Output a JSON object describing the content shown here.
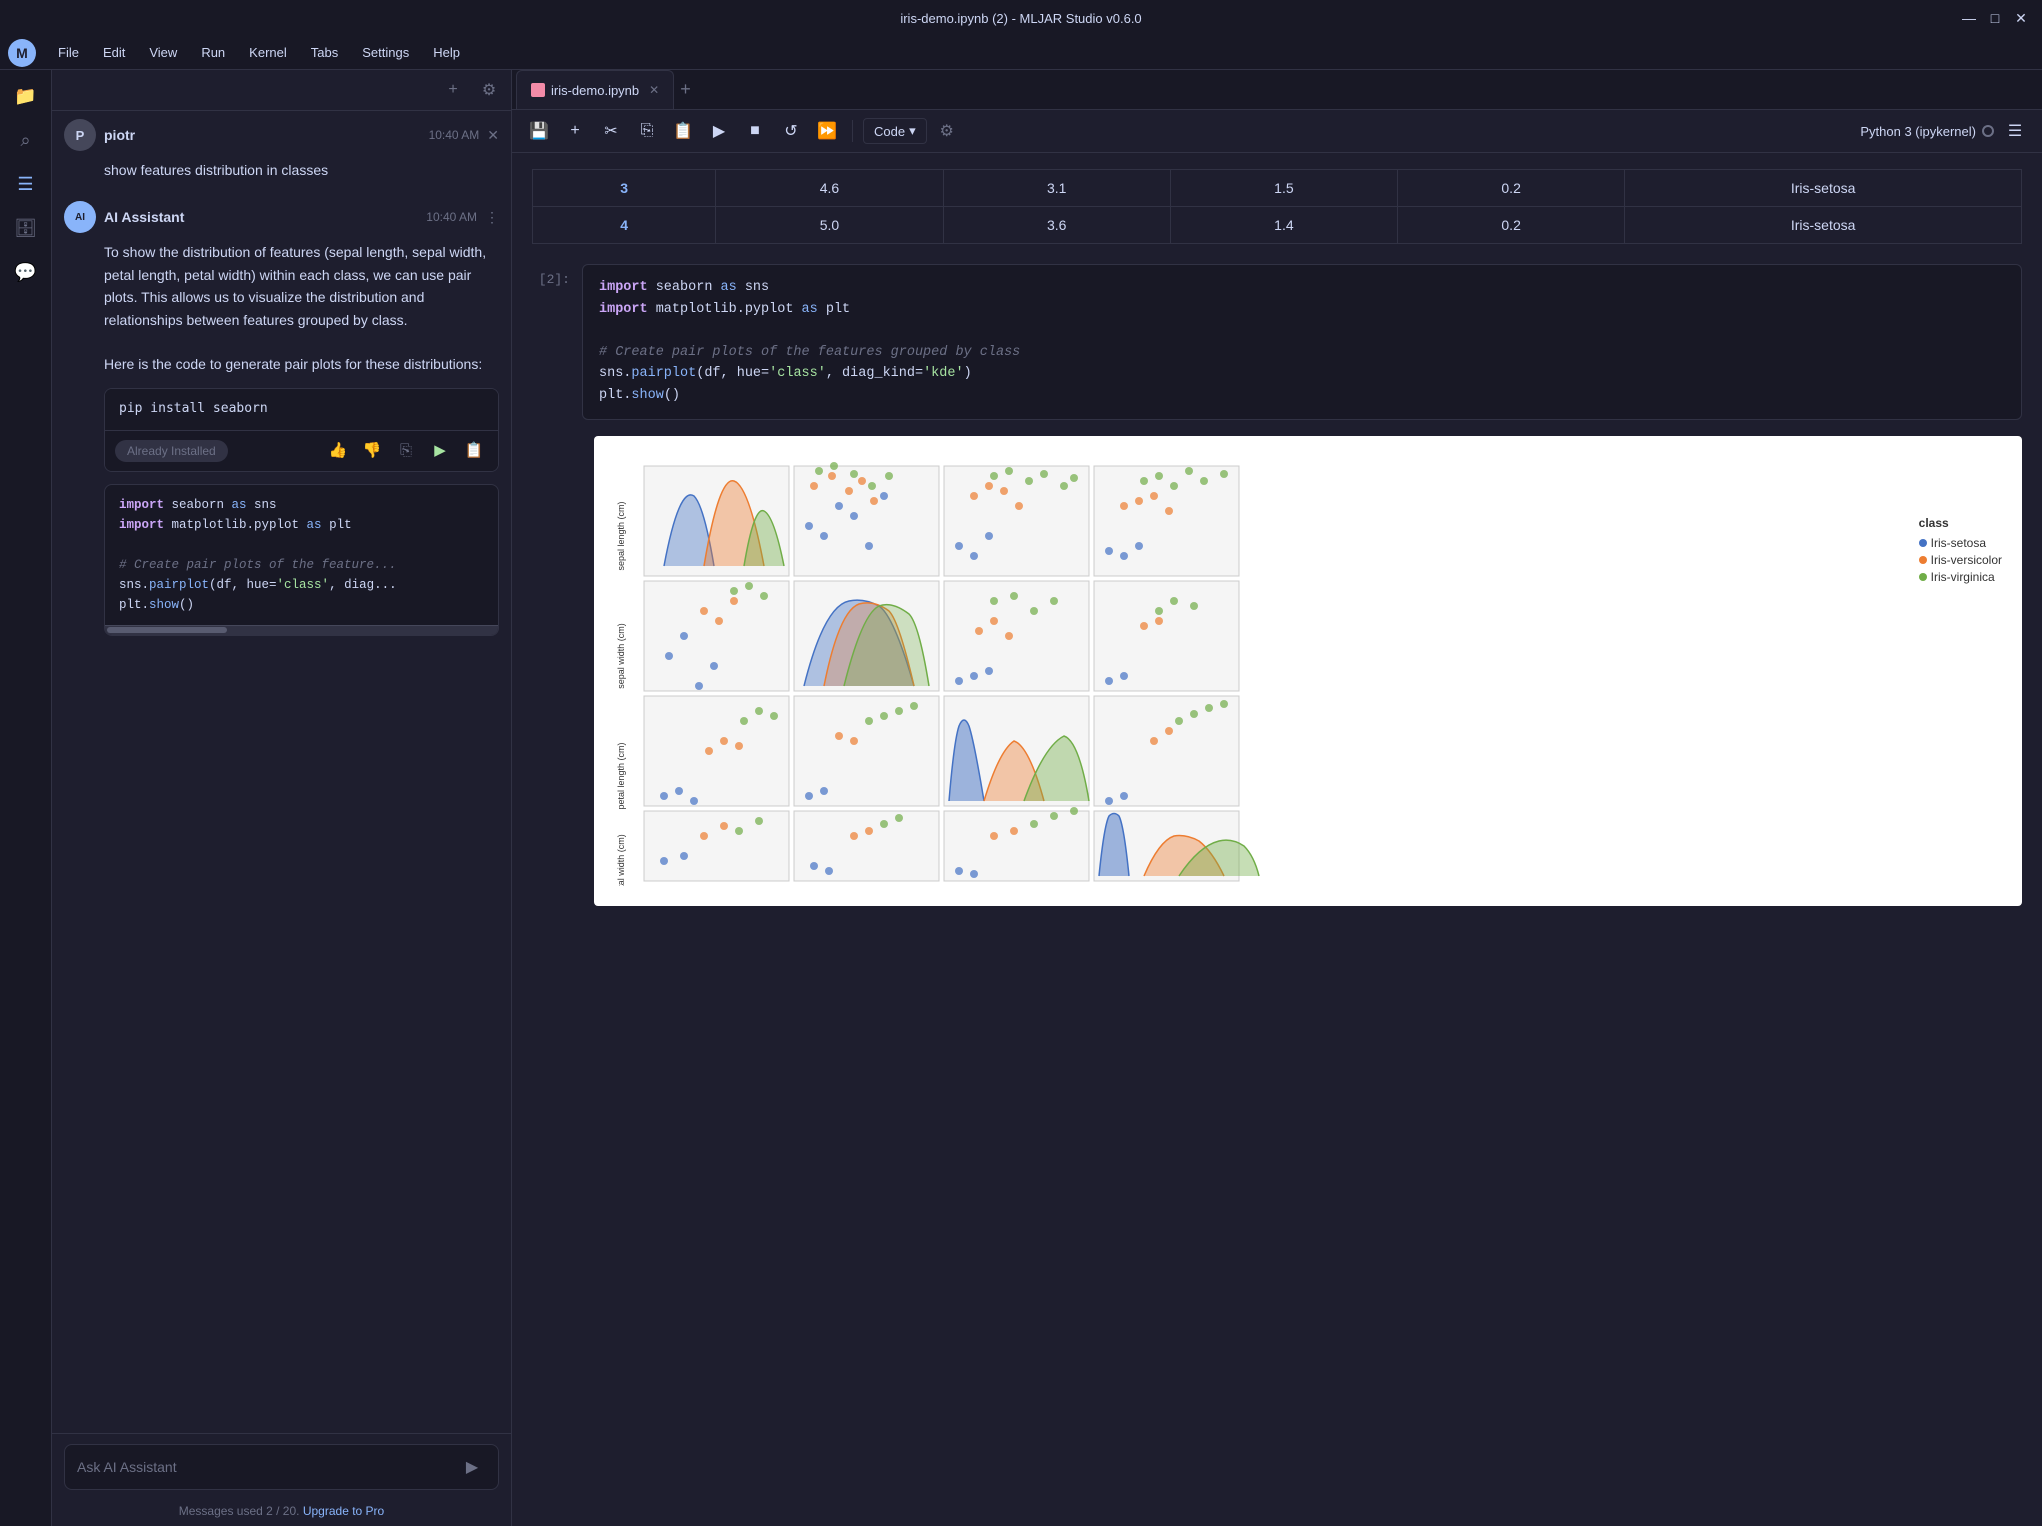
{
  "titlebar": {
    "title": "iris-demo.ipynb (2) - MLJAR Studio v0.6.0",
    "controls": [
      "minimize",
      "maximize",
      "close"
    ]
  },
  "menubar": {
    "logo": "M",
    "items": [
      "File",
      "Edit",
      "View",
      "Run",
      "Kernel",
      "Tabs",
      "Settings",
      "Help"
    ]
  },
  "sidebar": {
    "icons": [
      "files",
      "search",
      "list",
      "database",
      "chat"
    ]
  },
  "chat": {
    "header_buttons": [
      "+",
      "⚙"
    ],
    "messages": [
      {
        "role": "user",
        "sender": "piotr",
        "time": "10:40 AM",
        "content": "show features distribution in classes"
      },
      {
        "role": "ai",
        "sender": "AI Assistant",
        "time": "10:40 AM",
        "content_para1": "To show the distribution of features (sepal length, sepal width, petal length, petal width) within each class, we can use pair plots. This allows us to visualize the distribution and relationships between features grouped by class.",
        "content_para2": "Here is the code to generate pair plots for these distributions:",
        "pip_code": "pip install seaborn",
        "already_installed": "Already Installed",
        "code_block": "import seaborn as sns\nimport matplotlib.pyplot as plt\n\n# Create pair plots of the features grouped by class\nsns.pairplot(df, hue='class', diag_kind='kde')\nplt.show()"
      }
    ],
    "input_placeholder": "Ask AI Assistant",
    "send_btn": "▶",
    "footer_text": "Messages used 2 / 20.",
    "upgrade_label": "Upgrade to Pro"
  },
  "notebook": {
    "tab_name": "iris-demo.ipynb",
    "toolbar": {
      "code_mode": "Code",
      "kernel": "Python 3 (ipykernel)"
    },
    "table": {
      "rows": [
        {
          "index": "3",
          "col1": "4.6",
          "col2": "3.1",
          "col3": "1.5",
          "col4": "0.2",
          "class": "Iris-setosa"
        },
        {
          "index": "4",
          "col1": "5.0",
          "col2": "3.6",
          "col3": "1.4",
          "col4": "0.2",
          "class": "Iris-setosa"
        }
      ]
    },
    "cell_number": "[2]:",
    "code_lines": [
      "import seaborn as sns",
      "import matplotlib.pyplot as plt",
      "",
      "# Create pair plots of the features grouped by class",
      "sns.pairplot(df, hue='class', diag_kind='kde')",
      "plt.show()"
    ],
    "legend": {
      "title": "class",
      "items": [
        {
          "label": "Iris-setosa",
          "color": "#4472C4"
        },
        {
          "label": "Iris-versicolor",
          "color": "#ED7D31"
        },
        {
          "label": "Iris-virginica",
          "color": "#70AD47"
        }
      ]
    }
  }
}
